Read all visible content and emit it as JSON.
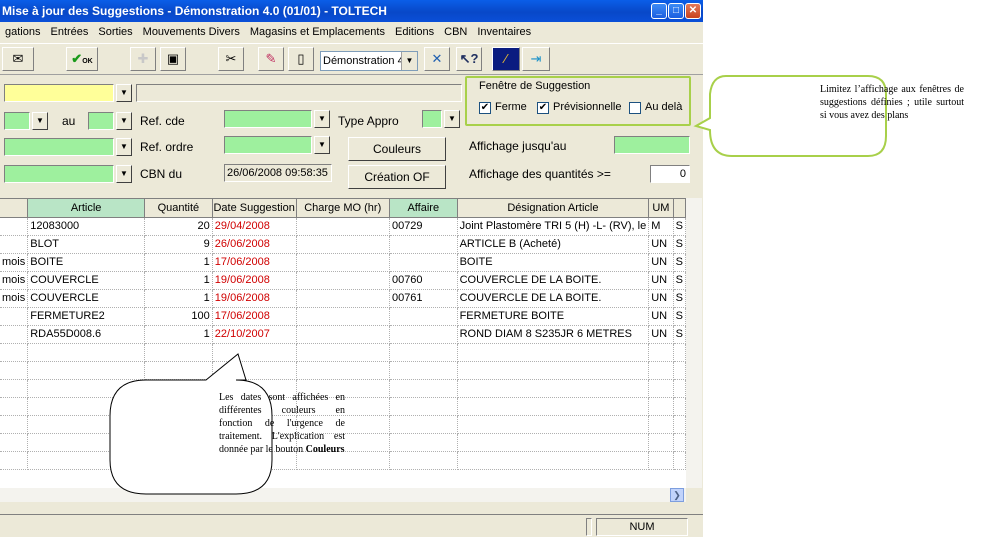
{
  "window": {
    "title": "Mise à jour des Suggestions - Démonstration 4.0 (01/01) - TOLTECH"
  },
  "menu": [
    "gations",
    "Entrées",
    "Sorties",
    "Mouvements Divers",
    "Magasins et Emplacements",
    "Editions",
    "CBN",
    "Inventaires"
  ],
  "toolbar": {
    "ok_label": "OK",
    "site_select": "Démonstration 4"
  },
  "filters": {
    "au_label": "au",
    "ref_cde_label": "Ref. cde",
    "type_appro_label": "Type Appro",
    "ref_ordre_label": "Ref. ordre",
    "cbn_du_label": "CBN du",
    "cbn_du_value": "26/06/2008 09:58:35",
    "couleurs_button": "Couleurs",
    "creation_of_button": "Création OF",
    "affichage_jusqu_label": "Affichage jusqu'au",
    "affichage_quantites_label": "Affichage des quantités >=",
    "affichage_quantites_value": "0"
  },
  "suggestion_window": {
    "legend": "Fenêtre de Suggestion",
    "ferme": {
      "label": "Ferme",
      "checked": true
    },
    "previsionnelle": {
      "label": "Prévisionnelle",
      "checked": true
    },
    "au_dela": {
      "label": "Au delà",
      "checked": false
    }
  },
  "grid": {
    "columns": [
      "",
      "Article",
      "Quantité",
      "Date Suggestion",
      "Charge MO (hr)",
      "Affaire",
      "Désignation Article",
      "UM",
      ""
    ],
    "rows": [
      {
        "c0": "",
        "article": "12083000",
        "qty": "20",
        "date": "29/04/2008",
        "charge": "",
        "affaire": "00729",
        "designation": "Joint Plastomère TRI 5 (H) -L- (RV), le",
        "um": "M",
        "last": "S"
      },
      {
        "c0": "",
        "article": "BLOT",
        "qty": "9",
        "date": "26/06/2008",
        "charge": "",
        "affaire": "",
        "designation": "ARTICLE B (Acheté)",
        "um": "UN",
        "last": "S"
      },
      {
        "c0": "mois",
        "article": "BOITE",
        "qty": "1",
        "date": "17/06/2008",
        "charge": "",
        "affaire": "",
        "designation": "BOITE",
        "um": "UN",
        "last": "S"
      },
      {
        "c0": "mois",
        "article": "COUVERCLE",
        "qty": "1",
        "date": "19/06/2008",
        "charge": "",
        "affaire": "00760",
        "designation": "COUVERCLE DE LA BOITE.",
        "um": "UN",
        "last": "S"
      },
      {
        "c0": "mois",
        "article": "COUVERCLE",
        "qty": "1",
        "date": "19/06/2008",
        "charge": "",
        "affaire": "00761",
        "designation": "COUVERCLE DE LA BOITE.",
        "um": "UN",
        "last": "S"
      },
      {
        "c0": "",
        "article": "FERMETURE2",
        "qty": "100",
        "date": "17/06/2008",
        "charge": "",
        "affaire": "",
        "designation": "FERMETURE BOITE",
        "um": "UN",
        "last": "S"
      },
      {
        "c0": "",
        "article": "RDA55D008.6",
        "qty": "1",
        "date": "22/10/2007",
        "charge": "",
        "affaire": "",
        "designation": "ROND DIAM 8 S235JR 6 METRES",
        "um": "UN",
        "last": "S"
      }
    ]
  },
  "statusbar": {
    "num": "NUM"
  },
  "callouts": {
    "right": "Limitez l’affichage aux fenêtres de suggestions définies ; utile surtout si vous avez des plans",
    "bottom_text": "Les dates sont affichées en différentes couleurs en fonction de l'urgence de traitement. L'explication est donnée par le bouton",
    "bottom_bold": "Couleurs"
  }
}
